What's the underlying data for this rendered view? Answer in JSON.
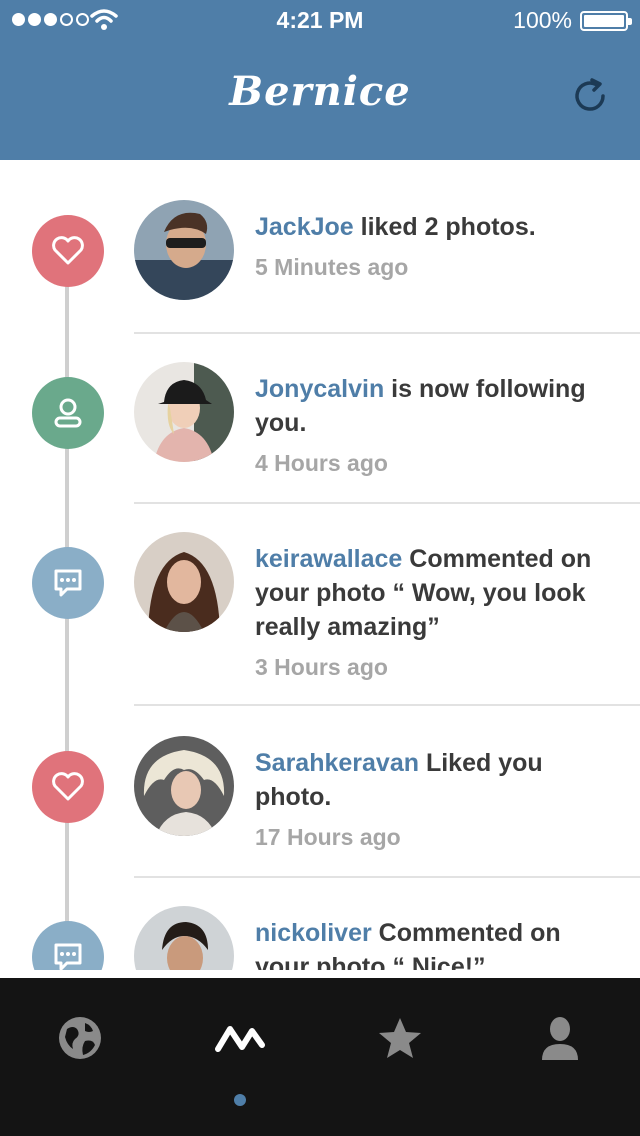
{
  "status_bar": {
    "time": "4:21 PM",
    "battery": "100%"
  },
  "header": {
    "title": "Bernice"
  },
  "feed": [
    {
      "user": "JackJoe",
      "action": " liked 2 photos.",
      "time": "5 Minutes ago",
      "type": "like"
    },
    {
      "user": "Jonycalvin",
      "action": " is now following you.",
      "time": "4 Hours ago",
      "type": "follow"
    },
    {
      "user": "keirawallace",
      "action": " Commented on your photo “ Wow, you look really amazing”",
      "time": "3 Hours ago",
      "type": "comment"
    },
    {
      "user": "Sarahkeravan",
      "action": " Liked you photo.",
      "time": "17 Hours ago",
      "type": "like"
    },
    {
      "user": "nickoliver",
      "action": " Commented on your photo “ Nice!”",
      "time": "",
      "type": "comment"
    }
  ],
  "tabbar": {
    "tabs": [
      {
        "icon": "globe-icon"
      },
      {
        "icon": "activity-icon",
        "active": true
      },
      {
        "icon": "star-icon"
      },
      {
        "icon": "user-icon"
      }
    ]
  },
  "colors": {
    "header": "#4f7ea8",
    "like": "#e0737b",
    "follow": "#6aa98c",
    "comment": "#8aaec7",
    "tabbar": "#141414"
  }
}
